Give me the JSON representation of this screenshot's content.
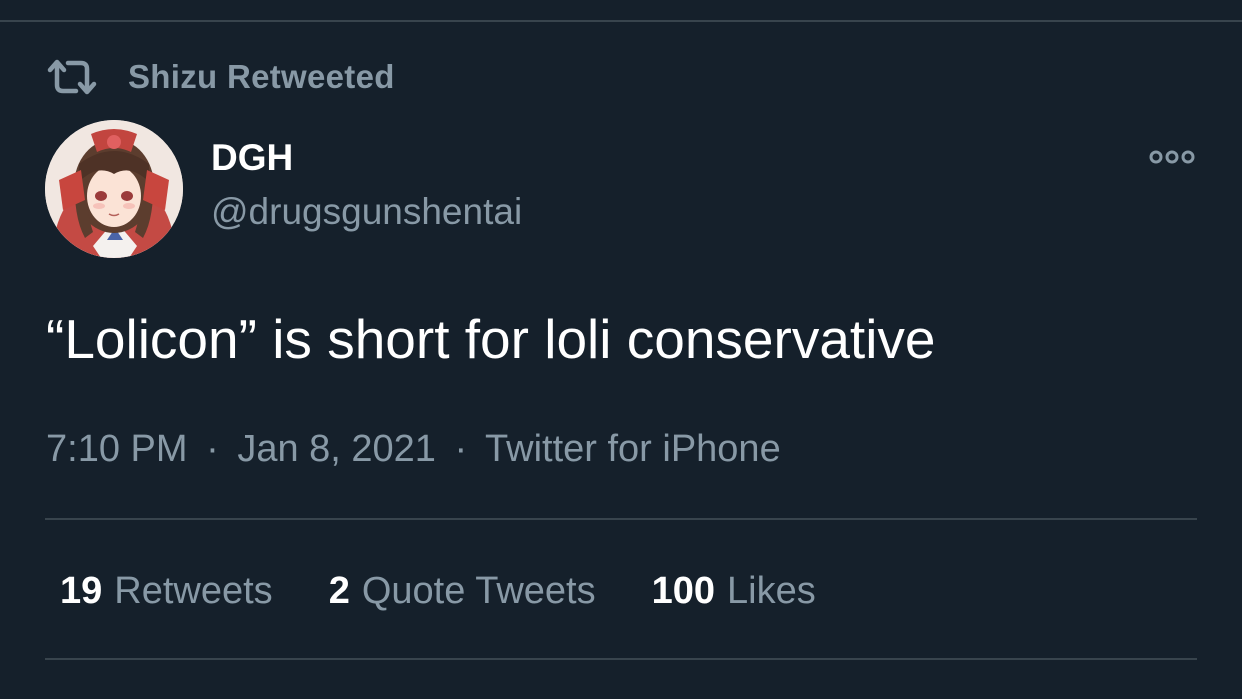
{
  "context": {
    "retweet_label": "Shizu Retweeted",
    "icon": "retweet-icon"
  },
  "author": {
    "display_name": "DGH",
    "handle": "@drugsgunshentai",
    "avatar": "anime-girl-avatar"
  },
  "tweet": {
    "text": "“Lolicon” is short for loli conservative",
    "time": "7:10 PM",
    "separator": "·",
    "date": "Jan 8, 2021",
    "source": "Twitter for iPhone"
  },
  "stats": {
    "retweets": {
      "count": "19",
      "label": "Retweets"
    },
    "quotes": {
      "count": "2",
      "label": "Quote Tweets"
    },
    "likes": {
      "count": "100",
      "label": "Likes"
    }
  },
  "more_icon": "more-options-icon",
  "colors": {
    "background": "#15202b",
    "primary_text": "#ffffff",
    "secondary_text": "#8899a6",
    "divider": "#38444d"
  }
}
